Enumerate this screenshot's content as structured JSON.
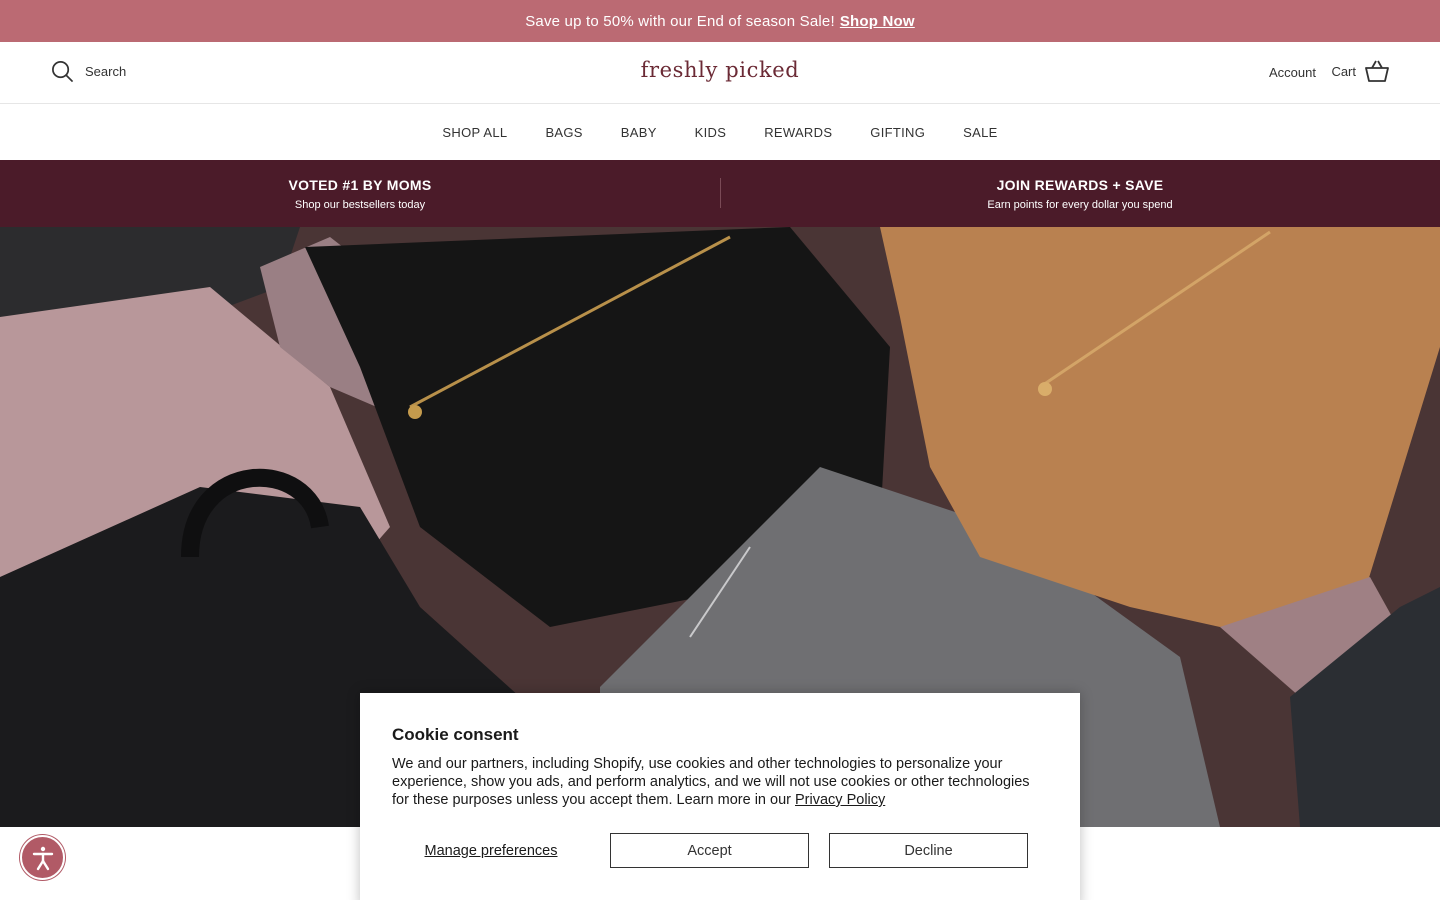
{
  "announcement": {
    "text": "Save up to 50% with our End of season Sale!",
    "link": "Shop Now"
  },
  "header": {
    "search_label": "Search",
    "logo": "freshly picked",
    "account_label": "Account",
    "cart_label": "Cart"
  },
  "nav": {
    "items": [
      "SHOP ALL",
      "BAGS",
      "BABY",
      "KIDS",
      "REWARDS",
      "GIFTING",
      "SALE"
    ]
  },
  "promo": {
    "left": {
      "title": "VOTED #1 BY MOMS",
      "subtitle": "Shop our bestsellers today"
    },
    "right": {
      "title": "JOIN REWARDS + SAVE",
      "subtitle": "Earn points for every dollar you spend"
    }
  },
  "cookie": {
    "title": "Cookie consent",
    "body": "We and our partners, including Shopify, use cookies and other technologies to personalize your experience, show you ads, and perform analytics, and we will not use cookies or other technologies for these purposes unless you accept them. Learn more in our",
    "privacy_link": "Privacy Policy",
    "manage_label": "Manage preferences",
    "accept_label": "Accept",
    "decline_label": "Decline"
  },
  "icons": {
    "search": "search-icon",
    "cart": "basket-icon",
    "accessibility": "accessibility-icon"
  },
  "colors": {
    "announcement_bg": "#bb6a73",
    "promo_bg": "#4b1b29",
    "logo": "#6b2a35",
    "accessibility_bg": "#b15a66"
  }
}
